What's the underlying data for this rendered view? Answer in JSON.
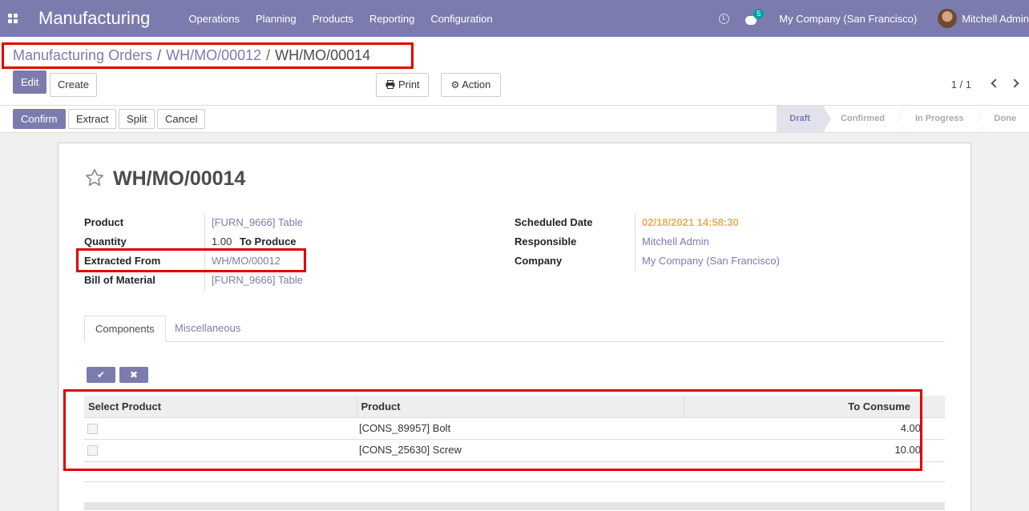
{
  "navbar": {
    "app_name": "Manufacturing",
    "menu": [
      "Operations",
      "Planning",
      "Products",
      "Reporting",
      "Configuration"
    ],
    "chat_badge": "5",
    "company": "My Company (San Francisco)",
    "user": "Mitchell Admin"
  },
  "breadcrumb": {
    "root": "Manufacturing Orders",
    "sep1": "/",
    "parent": "WH/MO/00012",
    "sep2": "/",
    "current": "WH/MO/00014"
  },
  "buttons": {
    "edit": "Edit",
    "create": "Create",
    "print": "Print",
    "action": "Action",
    "confirm": "Confirm",
    "extract": "Extract",
    "split": "Split",
    "cancel": "Cancel"
  },
  "pager": "1 / 1",
  "stages": [
    "Draft",
    "Confirmed",
    "In Progress",
    "Done"
  ],
  "record": {
    "title": "WH/MO/00014",
    "left_fields": [
      {
        "label": "Product",
        "value": "[FURN_9666] Table"
      },
      {
        "label": "Quantity",
        "value": "1.00",
        "suffix": "To Produce"
      },
      {
        "label": "Extracted From",
        "value": "WH/MO/00012"
      },
      {
        "label": "Bill of Material",
        "value": "[FURN_9666] Table"
      }
    ],
    "right_fields": [
      {
        "label": "Scheduled Date",
        "value": "02/18/2021 14:58:30"
      },
      {
        "label": "Responsible",
        "value": "Mitchell Admin"
      },
      {
        "label": "Company",
        "value": "My Company (San Francisco)"
      }
    ]
  },
  "tabs": [
    "Components",
    "Miscellaneous"
  ],
  "table": {
    "headers": [
      "Select Product",
      "Product",
      "To Consume"
    ],
    "rows": [
      {
        "product": "[CONS_89957] Bolt",
        "to_consume": "4.00"
      },
      {
        "product": "[CONS_25630] Screw",
        "to_consume": "10.00"
      }
    ]
  },
  "colors": {
    "brand": "#7c7bad",
    "scheduled_date": "#f0ad4e",
    "highlight": "#e00000"
  }
}
